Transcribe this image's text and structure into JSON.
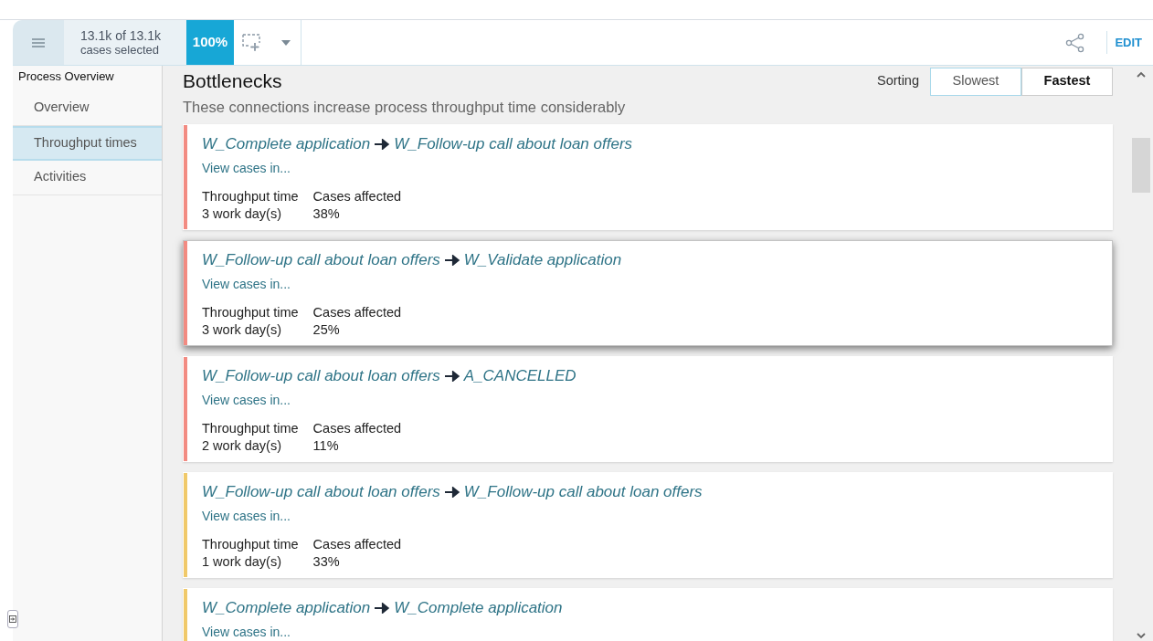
{
  "header": {
    "selection_count": "13.1k of 13.1k",
    "selection_label": "cases selected",
    "percentage": "100%",
    "edit": "EDIT"
  },
  "sidebar": {
    "heading": "Process Overview",
    "items": [
      {
        "label": "Overview",
        "selected": false
      },
      {
        "label": "Throughput times",
        "selected": true
      },
      {
        "label": "Activities",
        "selected": false
      }
    ]
  },
  "page": {
    "title": "Bottlenecks",
    "subtitle": "These connections increase process throughput time considerably",
    "sorting_label": "Sorting",
    "sort_options": [
      {
        "label": "Slowest",
        "selected": false
      },
      {
        "label": "Fastest",
        "selected": true
      }
    ]
  },
  "bottlenecks": [
    {
      "from": "W_Complete application",
      "to": "W_Follow-up call about loan offers",
      "link": "View cases in...",
      "color": "#f28b82",
      "highlighted": false,
      "stats": [
        {
          "label": "Throughput time",
          "value": "3 work day(s)"
        },
        {
          "label": "Cases affected",
          "value": "38%"
        }
      ]
    },
    {
      "from": "W_Follow-up call about loan offers",
      "to": "W_Validate application",
      "link": "View cases in...",
      "color": "#f28b82",
      "highlighted": true,
      "stats": [
        {
          "label": "Throughput time",
          "value": "3 work day(s)"
        },
        {
          "label": "Cases affected",
          "value": "25%"
        }
      ]
    },
    {
      "from": "W_Follow-up call about loan offers",
      "to": "A_CANCELLED",
      "link": "View cases in...",
      "color": "#f28b82",
      "highlighted": false,
      "stats": [
        {
          "label": "Throughput time",
          "value": "2 work day(s)"
        },
        {
          "label": "Cases affected",
          "value": "11%"
        }
      ]
    },
    {
      "from": "W_Follow-up call about loan offers",
      "to": "W_Follow-up call about loan offers",
      "link": "View cases in...",
      "color": "#f0c96a",
      "highlighted": false,
      "stats": [
        {
          "label": "Throughput time",
          "value": "1 work day(s)"
        },
        {
          "label": "Cases affected",
          "value": "33%"
        }
      ]
    },
    {
      "from": "W_Complete application",
      "to": "W_Complete application",
      "link": "View cases in...",
      "color": "#f0c96a",
      "highlighted": false
    }
  ]
}
